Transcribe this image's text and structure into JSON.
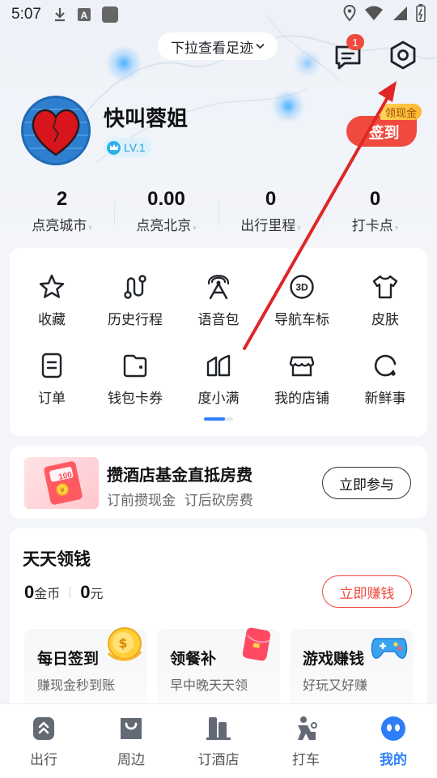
{
  "status_bar": {
    "time": "5:07",
    "icons": [
      "download-icon",
      "a-box-icon",
      "app-square-icon",
      "location-icon",
      "wifi-icon",
      "signal-icon",
      "battery-icon"
    ]
  },
  "header": {
    "pull_hint": "下拉查看足迹",
    "message_badge": "1",
    "icons": [
      "message-icon",
      "settings-icon"
    ]
  },
  "profile": {
    "username": "快叫蓉姐",
    "level": "LV.1",
    "signin_label": "签到",
    "signin_tag": "领现金"
  },
  "stats": [
    {
      "value": "2",
      "label": "点亮城市"
    },
    {
      "value": "0.00",
      "label": "点亮北京"
    },
    {
      "value": "0",
      "label": "出行里程"
    },
    {
      "value": "0",
      "label": "打卡点"
    }
  ],
  "grid": {
    "items": [
      {
        "label": "收藏",
        "icon": "star-icon"
      },
      {
        "label": "历史行程",
        "icon": "route-icon"
      },
      {
        "label": "语音包",
        "icon": "voice-icon"
      },
      {
        "label": "导航车标",
        "icon": "3d-icon"
      },
      {
        "label": "皮肤",
        "icon": "shirt-icon"
      },
      {
        "label": "订单",
        "icon": "order-icon"
      },
      {
        "label": "钱包卡券",
        "icon": "wallet-icon"
      },
      {
        "label": "度小满",
        "icon": "duxiaoman-icon"
      },
      {
        "label": "我的店铺",
        "icon": "store-icon"
      },
      {
        "label": "新鲜事",
        "icon": "news-icon"
      }
    ]
  },
  "hotel_banner": {
    "title": "攒酒店基金直抵房费",
    "subtitle": "订前攒现金  订后砍房费",
    "button": "立即参与",
    "image_text": "100"
  },
  "daily": {
    "title": "天天领钱",
    "coins_value": "0",
    "coins_unit": "金币",
    "cash_value": "0",
    "cash_unit": "元",
    "button": "立即赚钱",
    "tasks": [
      {
        "title": "每日签到",
        "subtitle": "赚现金秒到账",
        "icon": "coin-icon"
      },
      {
        "title": "领餐补",
        "subtitle": "早中晚天天领",
        "icon": "red-packet-icon"
      },
      {
        "title": "游戏赚钱",
        "subtitle": "好玩又好赚",
        "icon": "gamepad-icon"
      }
    ]
  },
  "bottom_nav": [
    {
      "label": "出行",
      "icon": "travel-icon"
    },
    {
      "label": "周边",
      "icon": "nearby-icon"
    },
    {
      "label": "订酒店",
      "icon": "hotel-icon"
    },
    {
      "label": "打车",
      "icon": "taxi-icon"
    },
    {
      "label": "我的",
      "icon": "mine-icon",
      "active": true
    }
  ],
  "colors": {
    "accent": "#2d7ff9",
    "red": "#f04a3f",
    "annotation_arrow": "#e02626"
  }
}
